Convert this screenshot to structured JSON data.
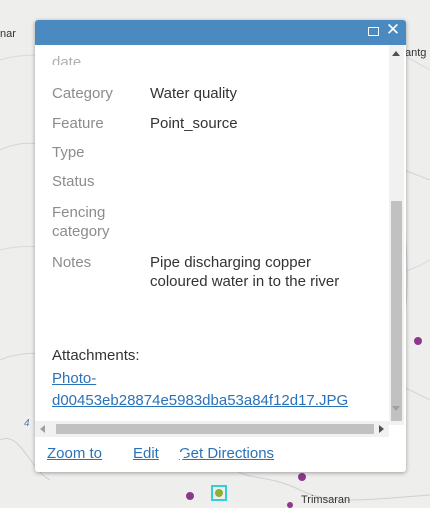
{
  "map": {
    "label_left": "nar",
    "label_right": "antg",
    "label_bottom": "Trimsaran",
    "side_marker": "4"
  },
  "popup": {
    "truncated_key": "date",
    "attributes": [
      {
        "key": "Category",
        "value": "Water quality"
      },
      {
        "key": "Feature",
        "value": "Point_source"
      },
      {
        "key": "Type",
        "value": ""
      },
      {
        "key": "Status",
        "value": ""
      },
      {
        "key": "Fencing category",
        "value": ""
      },
      {
        "key": "Notes",
        "value": "Pipe discharging copper coloured water in to the river"
      }
    ],
    "attachments_label": "Attachments:",
    "attachment_link": "Photo-d00453eb28874e5983dba53a84f12d17.JPG",
    "attachment_line1": "Photo-",
    "attachment_line2": "d00453eb28874e5983dba53a84f12d17.JPG",
    "actions": {
      "zoom_to": "Zoom to",
      "edit": "Edit",
      "get_directions": "Get Directions"
    }
  },
  "colors": {
    "header": "#4a8ac0",
    "link": "#2a72b8",
    "point": "#8b3a8b",
    "selection": "#2fd0d6"
  }
}
